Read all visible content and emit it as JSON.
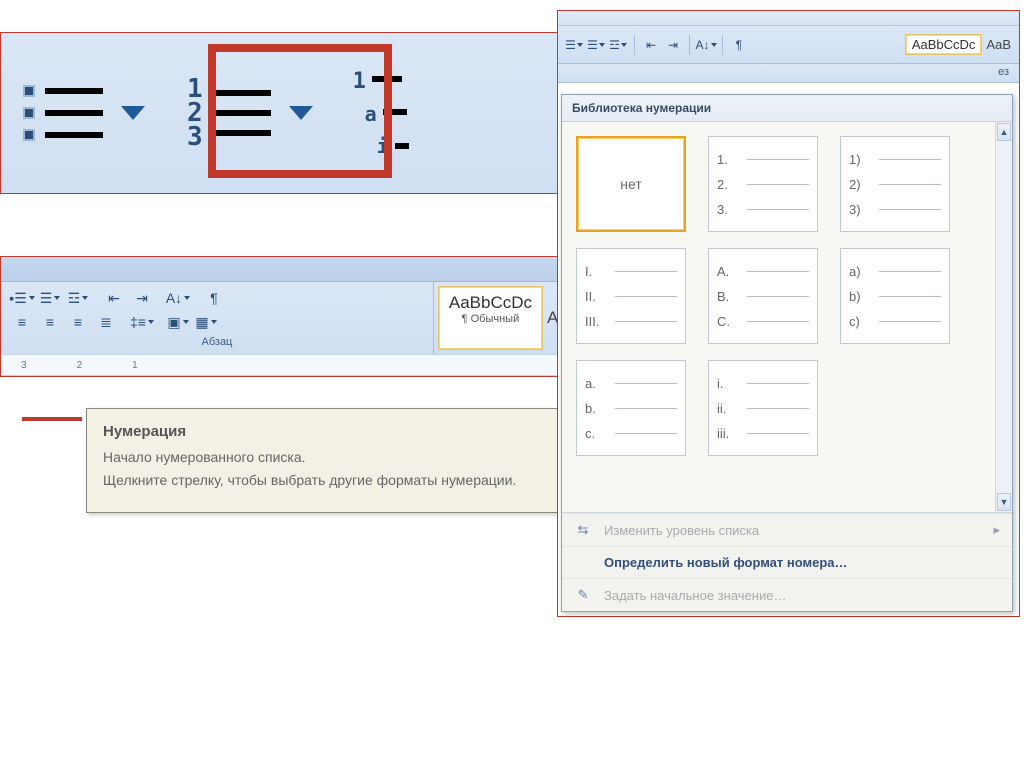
{
  "tooltip": {
    "title": "Нумерация",
    "line1": "Начало нумерованного списка.",
    "line2": "Щелкните стрелку, чтобы выбрать другие форматы нумерации."
  },
  "ribbon": {
    "group_label": "Абзац",
    "style_sample": "AaBbCcDc",
    "style_caption": "¶ Обычный",
    "style_sample2": "AaBbCcDc",
    "right_cut_label": "ез",
    "right_style2": "AaB"
  },
  "ruler": {
    "ticks": [
      "3",
      "2",
      "1"
    ]
  },
  "dropdown": {
    "title": "Библиотека нумерации",
    "tiles": [
      {
        "kind": "none",
        "label": "нет",
        "selected": true
      },
      {
        "labels": [
          "1.",
          "2.",
          "3."
        ]
      },
      {
        "labels": [
          "1)",
          "2)",
          "3)"
        ]
      },
      {
        "labels": [
          "I.",
          "II.",
          "III."
        ]
      },
      {
        "labels": [
          "A.",
          "B.",
          "C."
        ]
      },
      {
        "labels": [
          "a)",
          "b)",
          "c)"
        ]
      },
      {
        "labels": [
          "a.",
          "b.",
          "c."
        ]
      },
      {
        "labels": [
          "i.",
          "ii.",
          "iii."
        ]
      }
    ],
    "footer": {
      "change_level": "Изменить уровень списка",
      "define_format": "Определить новый формат номера…",
      "set_value": "Задать начальное значение…"
    }
  }
}
